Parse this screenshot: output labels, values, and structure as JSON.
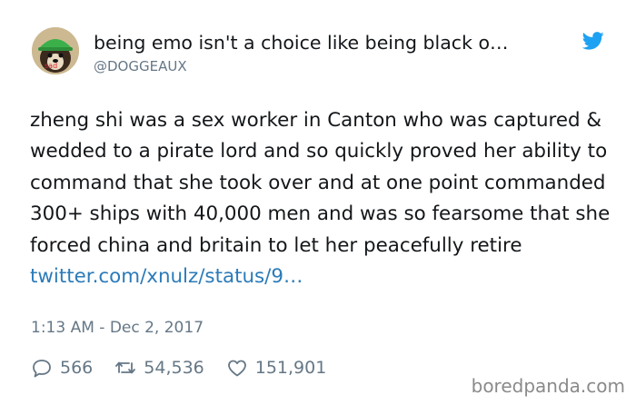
{
  "tweet": {
    "display_name": "being emo isn't a choice like being black o…",
    "handle": "@DOGGEAUX",
    "text": "zheng shi was a sex worker in Canton who was captured & wedded to a pirate lord and so quickly proved her ability to command that she took over and at one point commanded 300+ ships with 40,000 men and was so fearsome that she forced china and britain to let her peacefully retire",
    "link": "twitter.com/xnulz/status/9…",
    "timestamp": "1:13 AM - Dec 2, 2017",
    "replies": "566",
    "retweets": "54,536",
    "likes": "151,901"
  },
  "icons": {
    "avatar": "dog-with-green-hat-avatar",
    "brand": "twitter-bird-icon",
    "reply": "speech-bubble-icon",
    "retweet": "retweet-arrows-icon",
    "like": "heart-icon"
  },
  "colors": {
    "link": "#2b7bb9",
    "twitter_blue": "#1da1f2",
    "muted": "#657786"
  },
  "watermark": "boredpanda.com"
}
